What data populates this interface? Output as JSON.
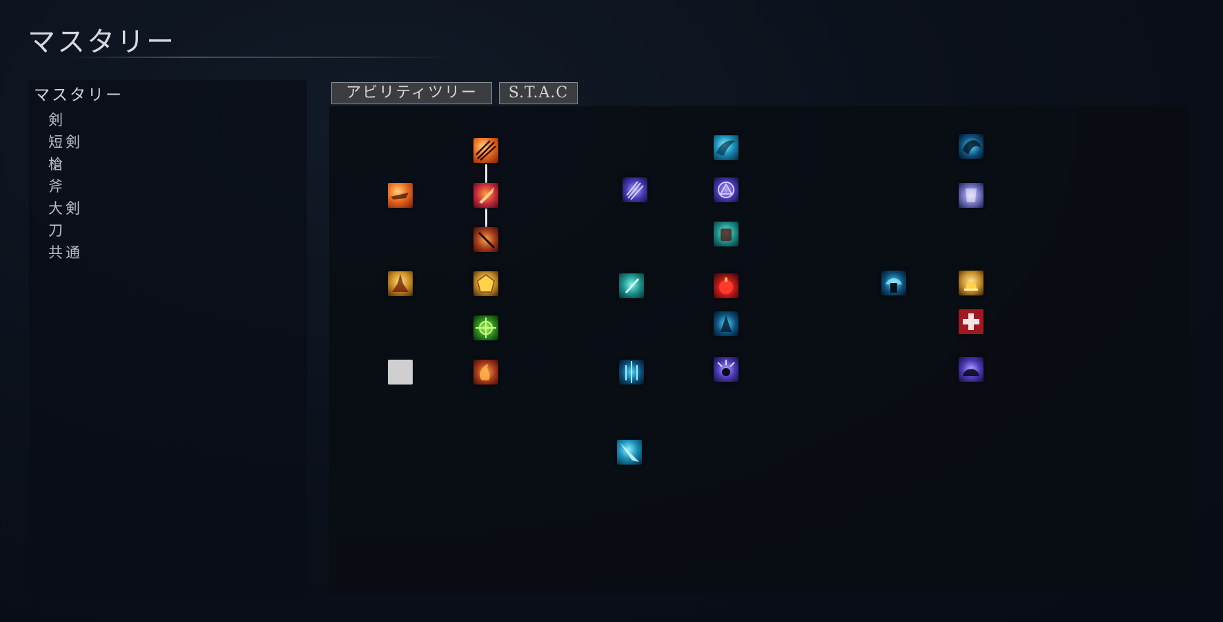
{
  "page": {
    "title": "マスタリー"
  },
  "sidebar": {
    "heading": "マスタリー",
    "items": [
      {
        "label": "剣"
      },
      {
        "label": "短剣"
      },
      {
        "label": "槍"
      },
      {
        "label": "斧"
      },
      {
        "label": "大剣"
      },
      {
        "label": "刀"
      },
      {
        "label": "共通"
      }
    ]
  },
  "tabs": [
    {
      "label": "アビリティツリー",
      "active": true
    },
    {
      "label": "S.T.A.C",
      "active": false
    }
  ],
  "colors": {
    "background": "#0b111b",
    "tab_background": "#3b3d40",
    "tab_border": "#8b8e92",
    "connector": "#e8e8e8"
  },
  "ability_tree": {
    "nodes": [
      {
        "id": "n1",
        "icon": "multi-slash-icon"
      },
      {
        "id": "n2",
        "icon": "flame-dash-icon"
      },
      {
        "id": "n3",
        "icon": "blazing-blade-icon"
      },
      {
        "id": "n4",
        "icon": "fire-strike-icon"
      },
      {
        "id": "n5",
        "icon": "fire-pillar-icon"
      },
      {
        "id": "n6",
        "icon": "amber-crystal-icon"
      },
      {
        "id": "n7",
        "icon": "crosshair-icon"
      },
      {
        "id": "n8",
        "icon": "empty-slot-icon"
      },
      {
        "id": "n9",
        "icon": "flame-swirl-icon"
      },
      {
        "id": "n10",
        "icon": "frost-wave-icon"
      },
      {
        "id": "n11",
        "icon": "triple-blade-icon"
      },
      {
        "id": "n12",
        "icon": "arcane-rune-icon"
      },
      {
        "id": "n13",
        "icon": "ice-fist-icon"
      },
      {
        "id": "n14",
        "icon": "teal-blade-icon"
      },
      {
        "id": "n15",
        "icon": "red-orb-icon"
      },
      {
        "id": "n16",
        "icon": "frost-aura-icon"
      },
      {
        "id": "n17",
        "icon": "ice-pillar-icon"
      },
      {
        "id": "n18",
        "icon": "arcane-burst-icon"
      },
      {
        "id": "n19",
        "icon": "ice-lance-icon"
      },
      {
        "id": "n20",
        "icon": "frost-dragon-icon"
      },
      {
        "id": "n21",
        "icon": "spirit-shield-icon"
      },
      {
        "id": "n22",
        "icon": "hooded-figure-icon"
      },
      {
        "id": "n23",
        "icon": "golden-bell-icon"
      },
      {
        "id": "n24",
        "icon": "medical-cross-icon"
      },
      {
        "id": "n25",
        "icon": "shadow-beast-icon"
      }
    ]
  }
}
